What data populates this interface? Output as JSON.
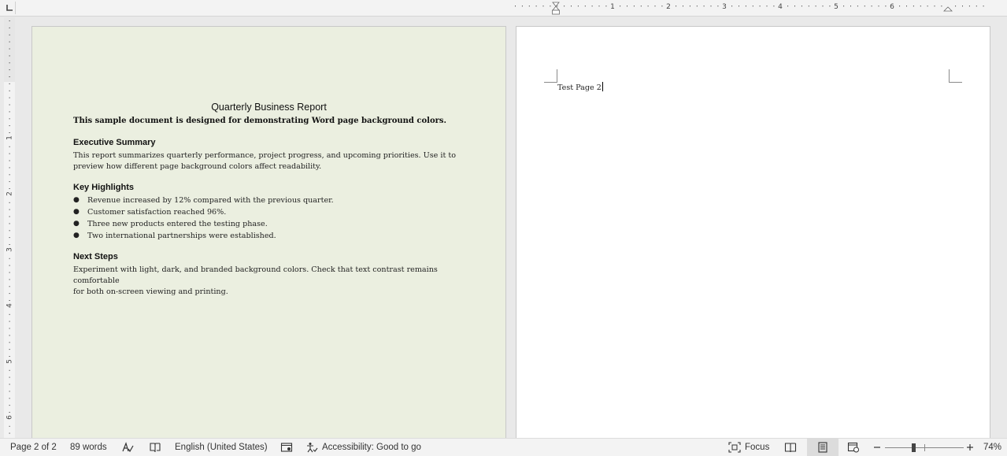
{
  "ruler": {
    "horizontal_labels": [
      "1",
      "2",
      "3",
      "4",
      "5",
      "6"
    ],
    "vertical_labels": [
      "1",
      "2",
      "3",
      "4",
      "5",
      "6"
    ]
  },
  "page1": {
    "background_color": "#ebefe0",
    "title": "Quarterly Business Report",
    "subtitle": "This sample document is designed for demonstrating Word page background colors.",
    "sections": [
      {
        "heading": "Executive Summary",
        "paragraph_lines": [
          "This report summarizes quarterly performance, project progress, and upcoming priorities. Use it to",
          "preview how different page background colors affect readability."
        ]
      },
      {
        "heading": "Key Highlights",
        "bullets": [
          "Revenue increased by 12% compared with the previous quarter.",
          "Customer satisfaction reached 96%.",
          "Three new products entered the testing phase.",
          "Two international partnerships were established."
        ]
      },
      {
        "heading": "Next Steps",
        "paragraph_lines": [
          "Experiment with light, dark, and branded background colors. Check that text contrast remains comfortable",
          "for both on-screen viewing and printing."
        ]
      }
    ]
  },
  "page2": {
    "background_color": "#ffffff",
    "text": "Test Page 2"
  },
  "status_bar": {
    "page_info": "Page 2 of 2",
    "word_count": "89 words",
    "language": "English (United States)",
    "accessibility": "Accessibility: Good to go",
    "focus": "Focus",
    "zoom": "74%",
    "zoom_level": 0.74
  },
  "icons": [
    "tab-selector-icon",
    "proofing-icon",
    "read-icon",
    "macro-icon",
    "accessibility-icon",
    "focus-icon",
    "read-mode-icon",
    "print-layout-icon",
    "web-layout-icon",
    "zoom-out-icon",
    "zoom-in-icon"
  ]
}
